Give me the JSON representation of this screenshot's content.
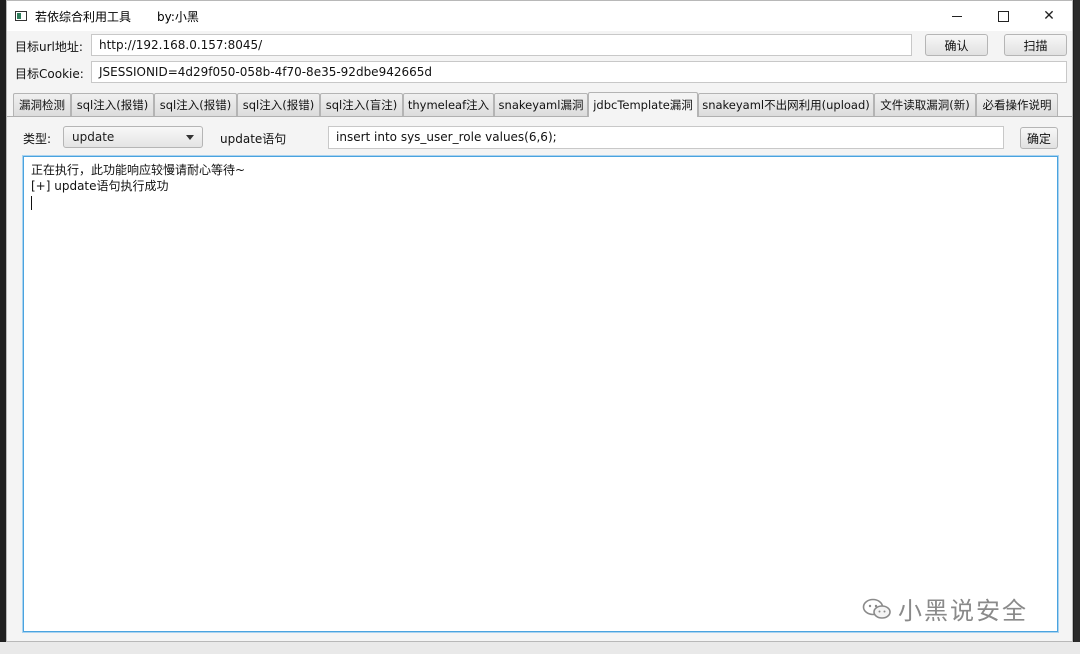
{
  "window": {
    "title": "若依综合利用工具",
    "author": "by:小黑"
  },
  "target": {
    "url_label": "目标url地址:",
    "url_value": "http://192.168.0.157:8045/",
    "cookie_label": "目标Cookie:",
    "cookie_value": "JSESSIONID=4d29f050-058b-4f70-8e35-92dbe942665d",
    "confirm_label": "确认",
    "scan_label": "扫描"
  },
  "tabs": [
    {
      "label": "漏洞检测"
    },
    {
      "label": "sql注入(报错)"
    },
    {
      "label": "sql注入(报错)"
    },
    {
      "label": "sql注入(报错)"
    },
    {
      "label": "sql注入(盲注)"
    },
    {
      "label": "thymeleaf注入"
    },
    {
      "label": "snakeyaml漏洞"
    },
    {
      "label": "jdbcTemplate漏洞"
    },
    {
      "label": "snakeyaml不出网利用(upload)"
    },
    {
      "label": "文件读取漏洞(新)"
    },
    {
      "label": "必看操作说明"
    }
  ],
  "active_tab": "jdbcTemplate漏洞",
  "panel": {
    "type_label": "类型:",
    "type_value": "update",
    "statement_label": "update语句",
    "statement_value": "insert into sys_user_role values(6,6);",
    "ok_label": "确定"
  },
  "output": {
    "lines": [
      "正在执行，此功能响应较慢请耐心等待~",
      "[+] update语句执行成功"
    ]
  },
  "watermark": {
    "text": "小黑说安全",
    "icon": "wechat-icon"
  }
}
